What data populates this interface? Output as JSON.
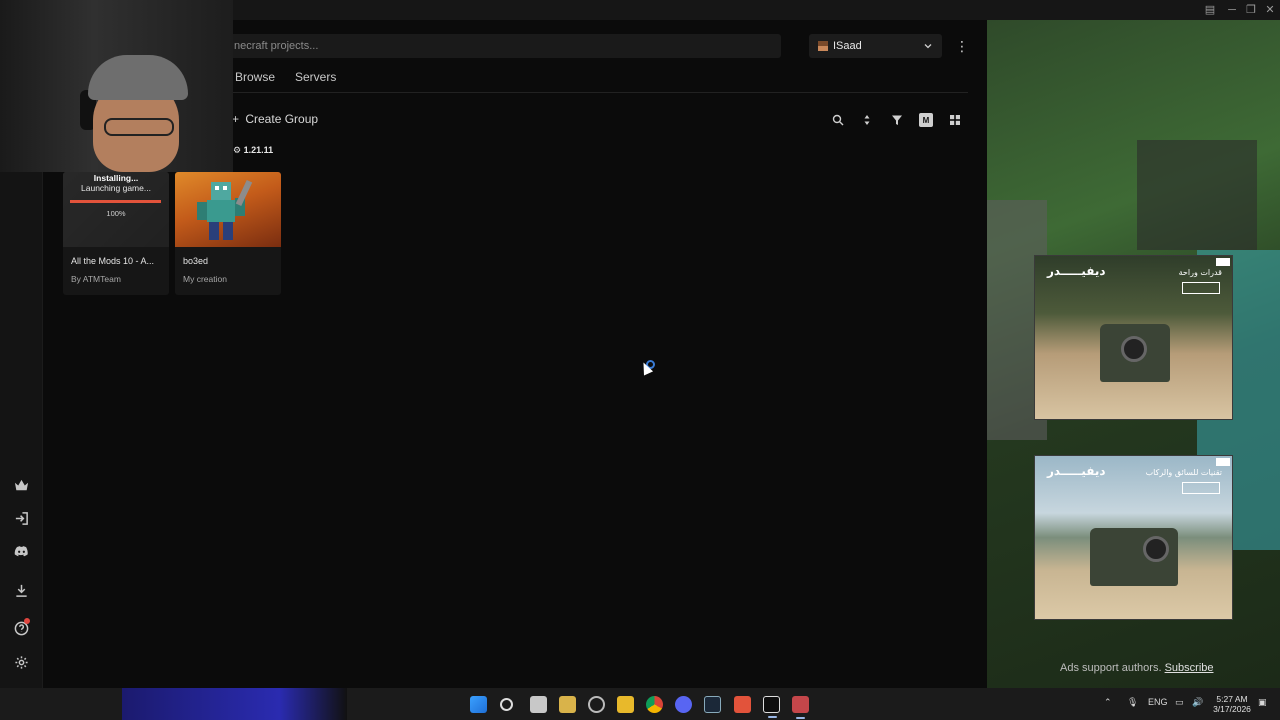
{
  "search": {
    "placeholder": "necraft projects..."
  },
  "profile": {
    "name": "ISaad"
  },
  "tabs": [
    {
      "label": "Browse"
    },
    {
      "label": "Servers"
    }
  ],
  "toolbar": {
    "create_group": "Create Group",
    "m_label": "M"
  },
  "instances": [
    {
      "title": "All the Mods 10 - A...",
      "author": "By ATMTeam",
      "status_title": "Installing...",
      "status_detail": "Launching game...",
      "progress_label": "100%",
      "progress": 1.0
    },
    {
      "title": "bo3ed",
      "author": "My creation",
      "version": "1.21.11"
    }
  ],
  "ads": {
    "brand": "ديفيـــــدر",
    "ad1_tag": "قدرات وراحة",
    "ad2_tag": "تقنيات للسائق والركاب",
    "support_text": "Ads support authors.",
    "subscribe": "Subscribe"
  },
  "taskbar": {
    "language": "ENG",
    "time": "5:27 AM",
    "date": "3/17/2026"
  },
  "colors": {
    "accent_progress": "#e2533b",
    "background": "#0b0b0b",
    "notification": "#e0463f"
  },
  "icons": {
    "sidebar": [
      "crown-icon",
      "sign-in-icon",
      "discord-icon",
      "download-icon",
      "help-icon",
      "gear-icon"
    ],
    "toolbar": [
      "search-icon",
      "sort-icon",
      "filter-icon",
      "grid-icon"
    ]
  }
}
